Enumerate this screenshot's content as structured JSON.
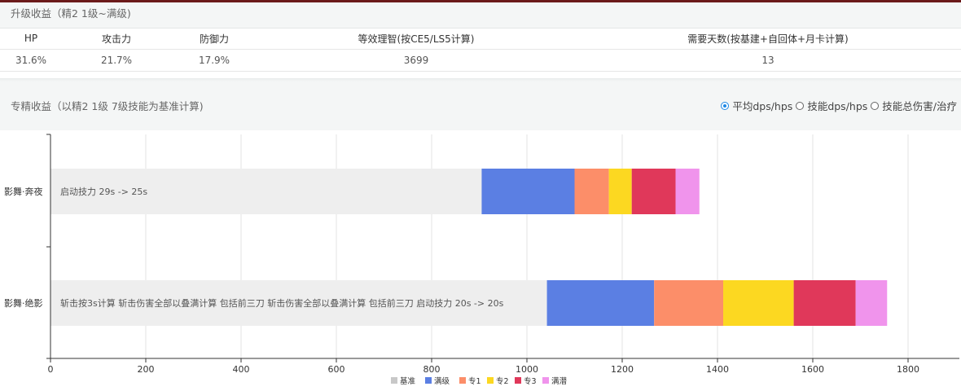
{
  "upgrade": {
    "title": "升级收益（精2 1级~满级)",
    "headers": [
      "HP",
      "攻击力",
      "防御力",
      "等效理智(按CE5/LS5计算)",
      "需要天数(按基建+自回体+月卡计算)"
    ],
    "values": [
      "31.6%",
      "21.7%",
      "17.9%",
      "3699",
      "13"
    ]
  },
  "mastery": {
    "title": "专精收益（以精2 1级 7级技能为基准计算)",
    "options": [
      {
        "label": "平均dps/hps",
        "selected": true
      },
      {
        "label": "技能dps/hps",
        "selected": false
      },
      {
        "label": "技能总伤害/治疗",
        "selected": false
      }
    ]
  },
  "colors": {
    "基准": "#eeeeee",
    "满级": "#5b7fe3",
    "专1": "#fc8e69",
    "专2": "#fcd821",
    "专3": "#e0385a",
    "满潜": "#f094ec"
  },
  "chart_data": {
    "type": "bar",
    "orientation": "horizontal",
    "stacked": true,
    "categories": [
      "影舞·奔夜",
      "影舞·绝影"
    ],
    "bar_labels": [
      "启动技力 29s -> 25s",
      "斩击按3s计算 斩击伤害全部以叠满计算 包括前三刀 斩击伤害全部以叠满计算 包括前三刀 启动技力 20s -> 20s"
    ],
    "series": [
      {
        "name": "基准",
        "values": [
          905,
          1042
        ]
      },
      {
        "name": "满级",
        "values": [
          195,
          225
        ]
      },
      {
        "name": "专1",
        "values": [
          72,
          145
        ]
      },
      {
        "name": "专2",
        "values": [
          48,
          148
        ]
      },
      {
        "name": "专3",
        "values": [
          92,
          130
        ]
      },
      {
        "name": "满潜",
        "values": [
          50,
          66
        ]
      }
    ],
    "xlim": [
      0,
      1900
    ],
    "xticks": [
      0,
      200,
      400,
      600,
      800,
      1000,
      1200,
      1400,
      1600,
      1800
    ],
    "grid": true,
    "legend": "bottom-center"
  }
}
